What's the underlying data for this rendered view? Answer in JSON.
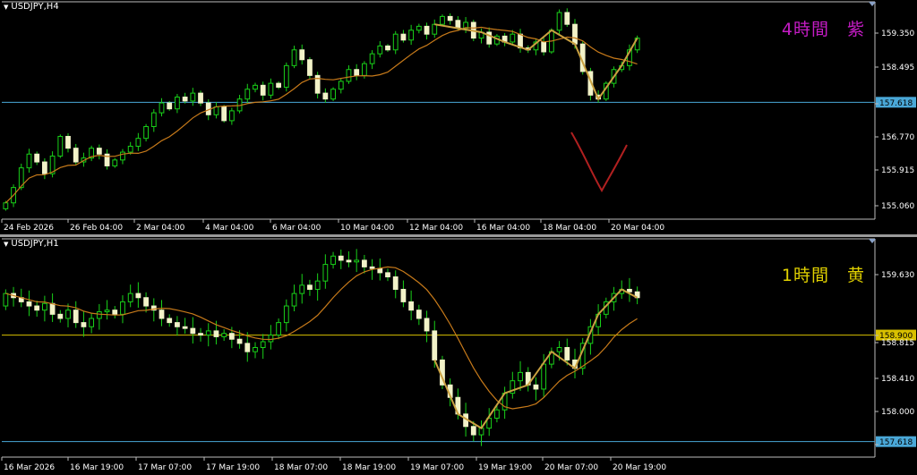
{
  "chart_data": [
    {
      "type": "candlestick",
      "symbol_label": "USDJPY,H4",
      "annotation": "4時間　紫",
      "y_ticks": [
        "159.350",
        "158.495",
        "157.618",
        "156.770",
        "155.915",
        "155.060"
      ],
      "x_ticks": [
        "24 Feb 2026",
        "26 Feb 04:00",
        "2 Mar 04:00",
        "4 Mar 04:00",
        "6 Mar 04:00",
        "10 Mar 04:00",
        "12 Mar 04:00",
        "16 Mar 04:00",
        "18 Mar 04:00",
        "20 Mar 04:00"
      ],
      "horizontal_line": {
        "value": 157.618,
        "label": "157.618",
        "color": "#4aa8d8"
      },
      "ylim": [
        154.85,
        159.9
      ],
      "close_prices": [
        155.06,
        155.45,
        155.95,
        156.3,
        156.1,
        155.8,
        156.25,
        156.75,
        156.45,
        156.1,
        156.2,
        156.45,
        156.3,
        156.0,
        156.15,
        156.35,
        156.5,
        156.7,
        157.0,
        157.35,
        157.6,
        157.45,
        157.75,
        157.65,
        157.85,
        157.6,
        157.3,
        157.5,
        157.15,
        157.4,
        157.7,
        157.95,
        158.05,
        157.8,
        158.1,
        158.0,
        158.55,
        158.95,
        158.7,
        158.3,
        157.85,
        157.7,
        157.95,
        158.15,
        158.45,
        158.3,
        158.6,
        158.85,
        159.05,
        158.95,
        159.35,
        159.2,
        159.45,
        159.55,
        159.35,
        159.6,
        159.8,
        159.7,
        159.5,
        159.65,
        159.25,
        159.4,
        159.1,
        159.3,
        159.15,
        159.35,
        159.0,
        158.95,
        159.15,
        158.9,
        159.45,
        159.9,
        159.6,
        159.1,
        158.4,
        157.8,
        157.7,
        158.1,
        158.45,
        158.55,
        158.95,
        159.25
      ],
      "ma_color": "#c77a1a",
      "zigzag_color": "#c9a040",
      "sketch_color": "#b02020"
    },
    {
      "type": "candlestick",
      "symbol_label": "USDJPY,H1",
      "annotation": "1時間　黄",
      "y_ticks": [
        "159.630",
        "158.900",
        "158.815",
        "158.410",
        "158.000",
        "157.618"
      ],
      "x_ticks": [
        "16 Mar 2026",
        "16 Mar 19:00",
        "17 Mar 07:00",
        "17 Mar 19:00",
        "18 Mar 07:00",
        "18 Mar 19:00",
        "19 Mar 07:00",
        "19 Mar 19:00",
        "20 Mar 07:00",
        "20 Mar 19:00"
      ],
      "horizontal_lines": [
        {
          "value": 158.9,
          "label": "158.900",
          "color": "#d8c000"
        },
        {
          "value": 157.618,
          "label": "157.618",
          "color": "#4aa8d8"
        }
      ],
      "ylim": [
        157.55,
        159.95
      ],
      "close_prices": [
        159.4,
        159.35,
        159.3,
        159.25,
        159.2,
        159.28,
        159.15,
        159.1,
        159.2,
        159.05,
        159.0,
        159.1,
        159.18,
        159.2,
        159.15,
        159.3,
        159.4,
        159.35,
        159.25,
        159.2,
        159.1,
        159.05,
        159.0,
        158.98,
        158.92,
        158.9,
        158.95,
        158.88,
        158.92,
        158.85,
        158.8,
        158.7,
        158.75,
        158.82,
        158.9,
        159.05,
        159.25,
        159.4,
        159.5,
        159.45,
        159.55,
        159.75,
        159.85,
        159.8,
        159.78,
        159.8,
        159.72,
        159.7,
        159.65,
        159.6,
        159.45,
        159.3,
        159.2,
        159.1,
        158.95,
        158.6,
        158.3,
        158.15,
        157.95,
        157.8,
        157.7,
        157.78,
        157.9,
        158.0,
        158.2,
        158.35,
        158.45,
        158.3,
        158.25,
        158.55,
        158.7,
        158.75,
        158.6,
        158.5,
        158.8,
        159.0,
        159.15,
        159.3,
        159.4,
        159.45,
        159.42,
        159.35
      ],
      "ma_color": "#c77a1a",
      "zigzag_color": "#c9a040"
    }
  ]
}
